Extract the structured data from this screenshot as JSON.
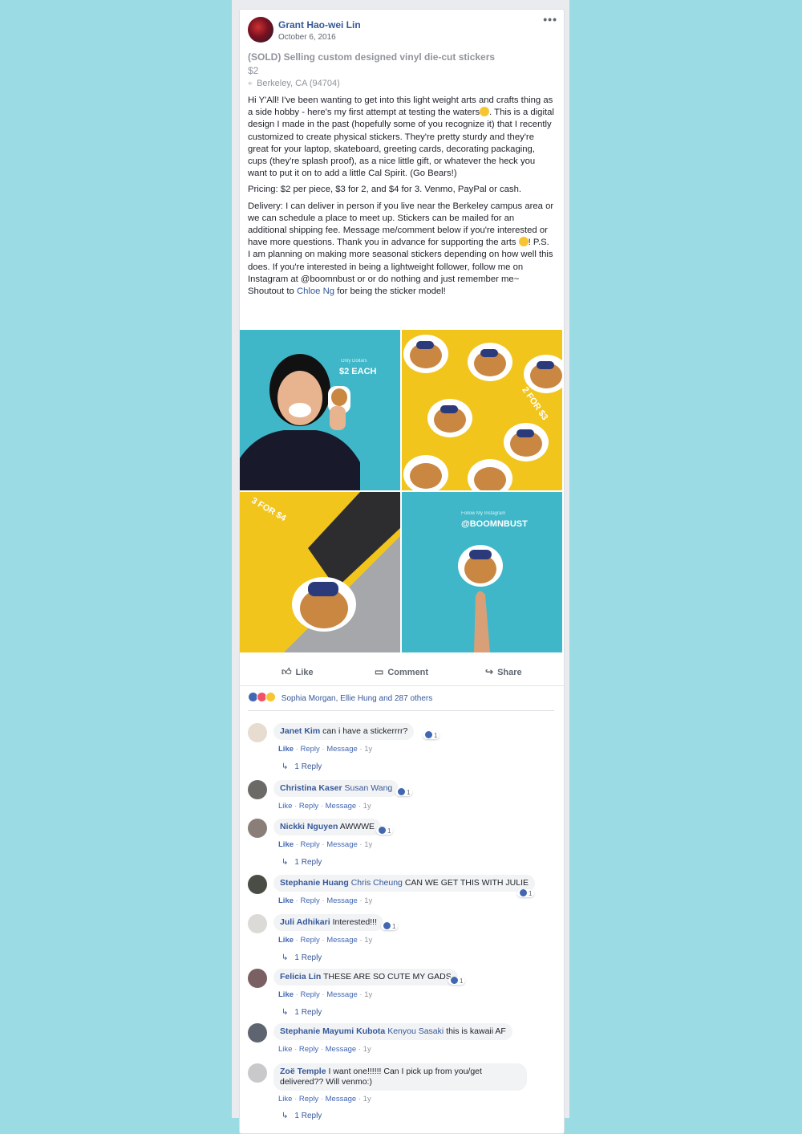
{
  "post": {
    "author": "Grant Hao-wei Lin",
    "date": "October 6, 2016",
    "more_icon": "ellipsis-icon",
    "listing_title": "(SOLD) Selling custom designed vinyl die-cut stickers",
    "price": "$2",
    "location": "Berkeley, CA (94704)",
    "body_p1": "Hi Y'All! I've been wanting to get into this light weight arts and crafts thing as a side hobby - here's my first attempt at testing the waters",
    "body_p1_end": ". This is a digital design I made in the past (hopefully some of you recognize it) that I recently customized to create physical stickers. They're pretty sturdy and they're great for your laptop, skateboard, greeting cards, decorating packaging, cups (they're splash proof), as a nice little gift, or whatever the heck you want to put it on to add a little Cal Spirit. (Go Bears!)",
    "body_p2": "Pricing: $2 per piece, $3 for 2, and $4 for 3. Venmo, PayPal or cash.",
    "body_p3_a": "Delivery: I can deliver in person if you live near the Berkeley campus area or we can schedule a place to meet up. Stickers can be mailed for an additional shipping fee. Message me/comment below if you're interested or have more questions. Thank you in advance for supporting the arts",
    "body_p3_b": "! P.S. I am planning on making more seasonal stickers depending on how well this does. If you're interested in being a lightweight follower, follow me on Instagram at @boomnbust or or do nothing and just remember me~ Shoutout to",
    "body_p3_link": "Chloe Ng",
    "body_p3_c": "for being the sticker model!"
  },
  "photos": {
    "p1_caption_small": "Only Dollars",
    "p1_caption": "$2 EACH",
    "p2_caption": "2 FOR $3",
    "p3_caption": "3 FOR $4",
    "p4_caption_small": "Follow My Instagram",
    "p4_caption": "@BOOMNBUST"
  },
  "actions": {
    "like": "Like",
    "comment": "Comment",
    "share": "Share"
  },
  "reactions_text": "Sophia Morgan, Ellie Hung and 287 others",
  "comment_meta": {
    "like": "Like",
    "reply": "Reply",
    "message": "Message",
    "age": "1y",
    "sep": "·"
  },
  "comments": [
    {
      "name": "Janet Kim",
      "tag": "",
      "text": "can i have a stickerrrr?",
      "likes": "1",
      "replies": "1 Reply"
    },
    {
      "name": "Christina Kaser",
      "tag": "Susan Wang",
      "text": "",
      "likes": "1",
      "replies": ""
    },
    {
      "name": "Nickki Nguyen",
      "tag": "",
      "text": "AWWWE",
      "likes": "1",
      "replies": "1 Reply"
    },
    {
      "name": "Stephanie Huang",
      "tag": "Chris Cheung",
      "text": "CAN WE GET THIS WITH JULIE",
      "likes": "1",
      "replies": ""
    },
    {
      "name": "Juli Adhikari",
      "tag": "",
      "text": "Interested!!!",
      "likes": "1",
      "replies": "1 Reply"
    },
    {
      "name": "Felicia Lin",
      "tag": "",
      "text": "THESE ARE SO CUTE MY GADS",
      "likes": "1",
      "replies": "1 Reply"
    },
    {
      "name": "Stephanie Mayumi Kubota",
      "tag": "Kenyou Sasaki",
      "text": "this is kawaii AF",
      "likes": "",
      "replies": ""
    },
    {
      "name": "Zoë Temple",
      "tag": "",
      "text": "I want one!!!!!! Can I pick up from you/get delivered?? Will venmo:)",
      "likes": "",
      "replies": "1 Reply"
    }
  ]
}
